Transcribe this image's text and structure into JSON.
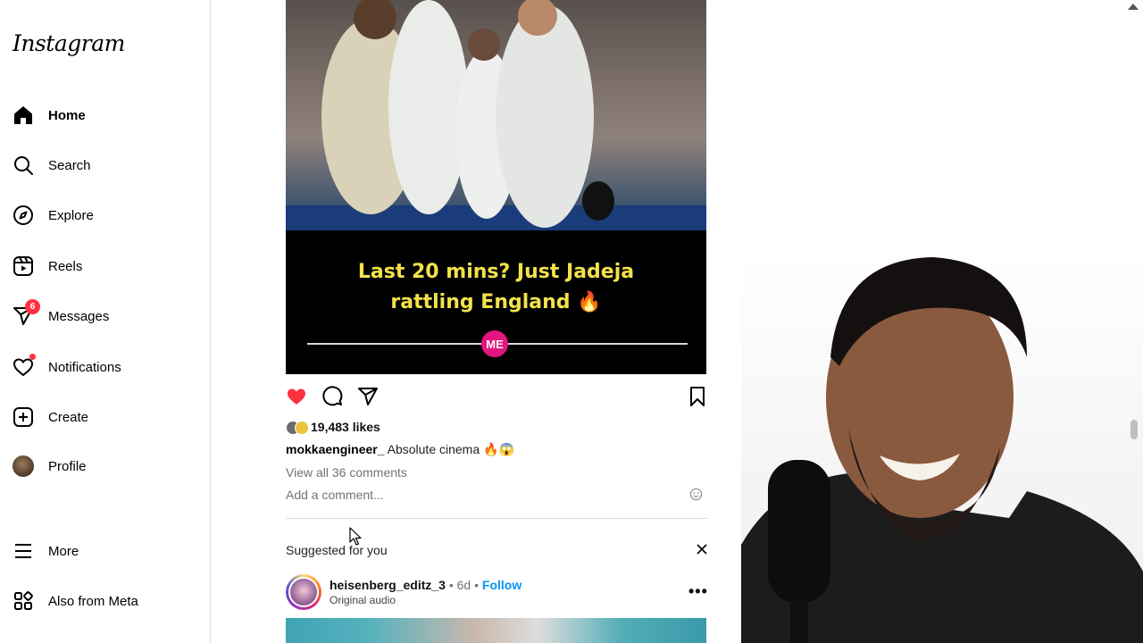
{
  "app": {
    "logo": "Instagram"
  },
  "sidebar": {
    "items": [
      {
        "label": "Home",
        "icon": "home-icon",
        "active": true
      },
      {
        "label": "Search",
        "icon": "search-icon"
      },
      {
        "label": "Explore",
        "icon": "compass-icon"
      },
      {
        "label": "Reels",
        "icon": "reels-icon"
      },
      {
        "label": "Messages",
        "icon": "send-icon",
        "badge": "6"
      },
      {
        "label": "Notifications",
        "icon": "heart-icon",
        "dot": true
      },
      {
        "label": "Create",
        "icon": "plus-square-icon"
      },
      {
        "label": "Profile",
        "icon": "avatar"
      }
    ],
    "bottom": [
      {
        "label": "More",
        "icon": "menu-icon"
      },
      {
        "label": "Also from Meta",
        "icon": "meta-apps-icon"
      }
    ]
  },
  "post": {
    "overlay_line1": "Last 20 mins? Just Jadeja",
    "overlay_line2": "rattling England 🔥",
    "watermark": "ME",
    "liked": true,
    "like_color": "#ff3040",
    "likes": "19,483 likes",
    "caption_user": "mokkaengineer_",
    "caption_text": "Absolute cinema 🔥😱",
    "view_comments": "View all 36 comments",
    "add_comment_placeholder": "Add a comment..."
  },
  "suggested": {
    "heading": "Suggested for you",
    "username": "heisenberg_editz_3",
    "time": "6d",
    "follow_label": "Follow",
    "audio": "Original audio"
  },
  "colors": {
    "accent": "#0095f6",
    "notification": "#ff3040",
    "overlay_text": "#f3e24a"
  }
}
